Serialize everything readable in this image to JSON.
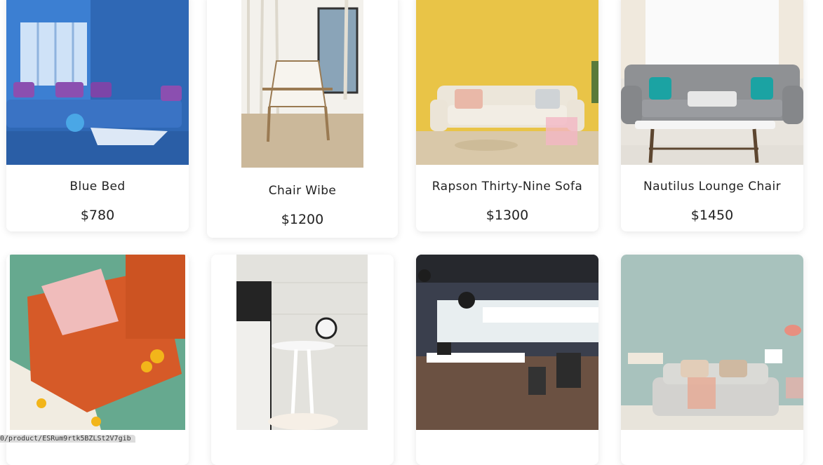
{
  "products": [
    {
      "name": "Blue Bed",
      "price": "$780"
    },
    {
      "name": "Chair Wibe",
      "price": "$1200"
    },
    {
      "name": "Rapson Thirty-Nine Sofa",
      "price": "$1300"
    },
    {
      "name": "Nautilus Lounge Chair",
      "price": "$1450"
    },
    {
      "name": "",
      "price": ""
    },
    {
      "name": "",
      "price": ""
    },
    {
      "name": "",
      "price": ""
    },
    {
      "name": "",
      "price": ""
    }
  ],
  "status_bar": {
    "url_text": "0/product/ESRum9rtk5BZLSt2V7gib"
  }
}
